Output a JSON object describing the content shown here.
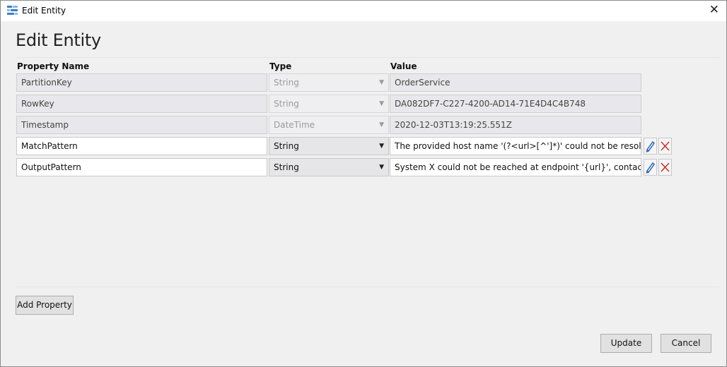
{
  "window": {
    "title": "Edit Entity",
    "icon": "storage-table-icon",
    "close": "✕"
  },
  "header": {
    "title": "Edit Entity"
  },
  "table": {
    "columns": [
      "Property Name",
      "Type",
      "Value"
    ],
    "rows": [
      {
        "name": "PartitionKey",
        "type": "String",
        "value": "OrderService",
        "editable": false
      },
      {
        "name": "RowKey",
        "type": "String",
        "value": "DA082DF7-C227-4200-AD14-71E4D4C4B748",
        "editable": false
      },
      {
        "name": "Timestamp",
        "type": "DateTime",
        "value": "2020-12-03T13:19:25.551Z",
        "editable": false
      },
      {
        "name": "MatchPattern",
        "type": "String",
        "value": "The provided host name '(?<url>[^']*)' could not be resolved",
        "editable": true
      },
      {
        "name": "OutputPattern",
        "type": "String",
        "value": "System X could not be reached at endpoint '{url}', contact John",
        "editable": true
      }
    ]
  },
  "icons": {
    "edit": "pencil-icon",
    "delete": "delete-x-icon",
    "dropdown": "▼"
  },
  "buttons": {
    "add_property": "Add Property",
    "update": "Update",
    "cancel": "Cancel"
  },
  "colors": {
    "pencil": "#1f5fb4",
    "delete": "#c42b1c"
  }
}
